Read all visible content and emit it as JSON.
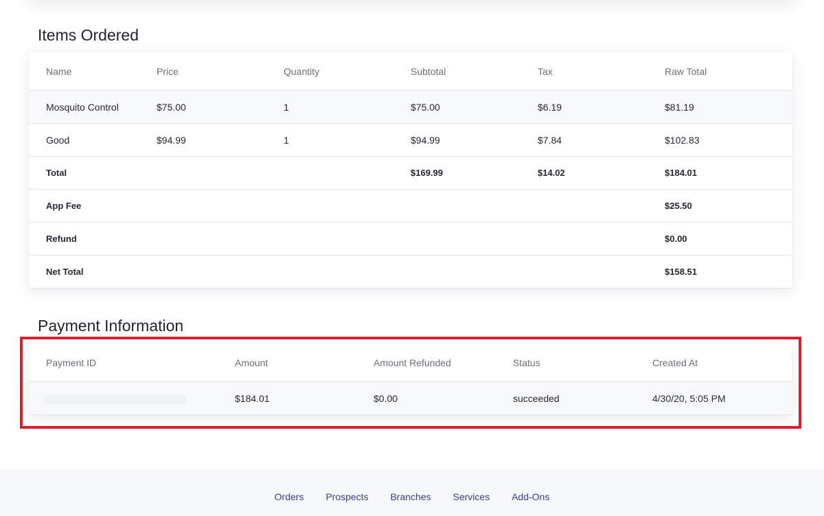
{
  "items_section": {
    "title": "Items Ordered",
    "columns": [
      "Name",
      "Price",
      "Quantity",
      "Subtotal",
      "Tax",
      "Raw Total"
    ],
    "rows": [
      {
        "name": "Mosquito Control",
        "price": "$75.00",
        "quantity": "1",
        "subtotal": "$75.00",
        "tax": "$6.19",
        "raw_total": "$81.19"
      },
      {
        "name": "Good",
        "price": "$94.99",
        "quantity": "1",
        "subtotal": "$94.99",
        "tax": "$7.84",
        "raw_total": "$102.83"
      }
    ],
    "total": {
      "label": "Total",
      "subtotal": "$169.99",
      "tax": "$14.02",
      "raw_total": "$184.01"
    },
    "app_fee": {
      "label": "App Fee",
      "value": "$25.50"
    },
    "refund": {
      "label": "Refund",
      "value": "$0.00"
    },
    "net_total": {
      "label": "Net Total",
      "value": "$158.51"
    }
  },
  "payment_section": {
    "title": "Payment Information",
    "columns": [
      "Payment ID",
      "Amount",
      "Amount Refunded",
      "Status",
      "Created At"
    ],
    "rows": [
      {
        "amount": "$184.01",
        "amount_refunded": "$0.00",
        "status": "succeeded",
        "created_at": "4/30/20, 5:05 PM"
      }
    ]
  },
  "footer": {
    "links": [
      "Orders",
      "Prospects",
      "Branches",
      "Services",
      "Add-Ons"
    ]
  },
  "colors": {
    "highlight_border": "#dc1f2f",
    "footer_link": "#3a3f88"
  }
}
